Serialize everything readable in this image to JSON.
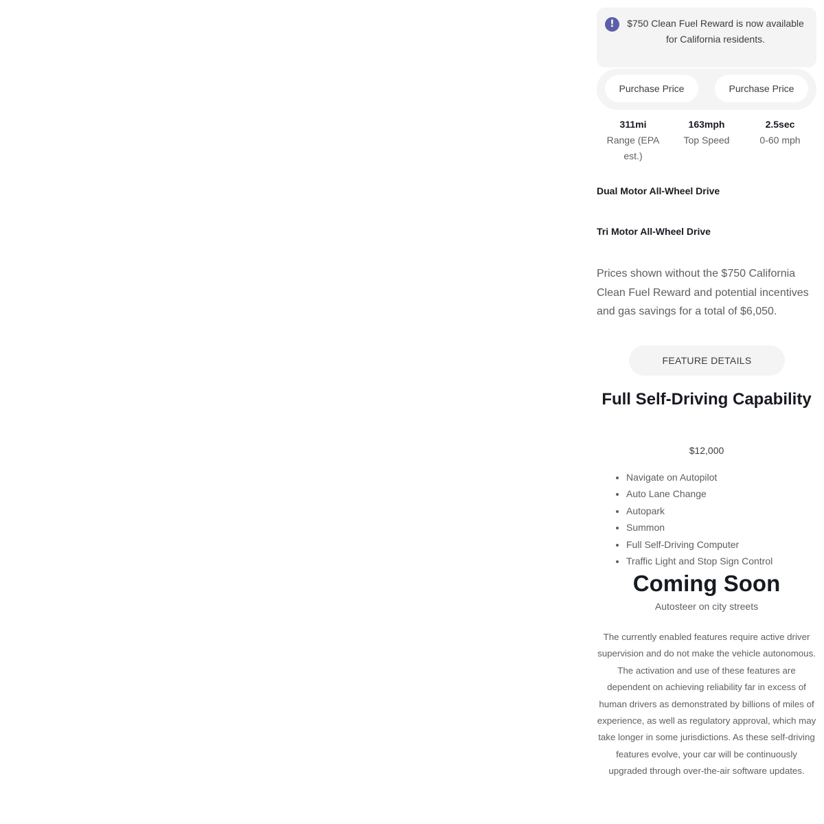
{
  "notice": {
    "icon": "exclamation-circle-icon",
    "icon_glyph": "!",
    "text": "$750 Clean Fuel Reward is now available for California residents."
  },
  "price_toggle": {
    "option_left": "Purchase Price",
    "option_right": "Purchase Price"
  },
  "specs": [
    {
      "value": "311mi",
      "label": "Range (EPA est.)"
    },
    {
      "value": "163mph",
      "label": "Top Speed"
    },
    {
      "value": "2.5sec",
      "label": "0-60 mph"
    }
  ],
  "drive_options": [
    {
      "label": "Dual Motor All-Wheel Drive"
    },
    {
      "label": "Tri Motor All-Wheel Drive"
    }
  ],
  "prices_note": "Prices shown without the $750 California Clean Fuel Reward and potential incentives and gas savings for a total of $6,050.",
  "feature_details_label": "FEATURE DETAILS",
  "fsd": {
    "title": "Full Self-Driving Capability",
    "price": "$12,000",
    "features": [
      "Navigate on Autopilot",
      "Auto Lane Change",
      "Autopark",
      "Summon",
      "Full Self-Driving Computer",
      "Traffic Light and Stop Sign Control"
    ]
  },
  "coming_soon": {
    "title": "Coming Soon",
    "subtitle": "Autosteer on city streets"
  },
  "disclaimer": "The currently enabled features require active driver supervision and do not make the vehicle autonomous. The activation and use of these features are dependent on achieving reliability far in excess of human drivers as demonstrated by billions of miles of experience, as well as regulatory approval, which may take longer in some jurisdictions. As these self-driving features evolve, your car will be continuously upgraded through over-the-air software updates.",
  "colors": {
    "accent": "#5c5fa8",
    "panel_bg": "#f4f4f4",
    "text_dark": "#171a20",
    "text_muted": "#5c5e62"
  }
}
